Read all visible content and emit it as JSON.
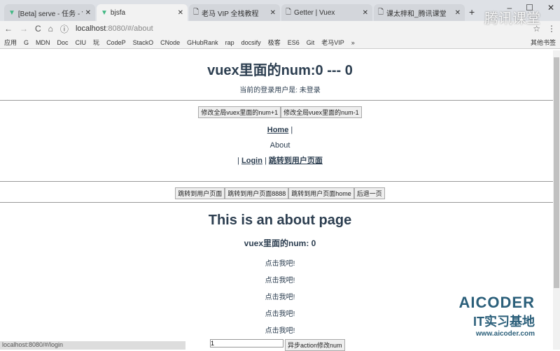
{
  "tabs": [
    {
      "label": "[Beta] serve - 任务 - Vue"
    },
    {
      "label": "bjsfa"
    },
    {
      "label": "老马 VIP 全栈教程"
    },
    {
      "label": "Getter | Vuex"
    },
    {
      "label": "课太梓和_腾讯课堂"
    }
  ],
  "url": {
    "host": "localhost",
    "rest": ":8080/#/about"
  },
  "bookmarks": [
    "应用",
    "G",
    "MDN",
    "Doc",
    "CIU",
    "玩",
    "CodeP",
    "StackO",
    "CNode",
    "GHubRank",
    "rap",
    "docsify",
    "极客",
    "ES6",
    "Git",
    "老马VIP",
    "»",
    "其他书签"
  ],
  "page": {
    "title": "vuex里面的num:0 --- 0",
    "user": "当前的登录用户是: 未登录",
    "buttons": [
      "修改全局vuex里面的num+1",
      "修改全局vuex里面的num-1"
    ],
    "nav": {
      "home": "Home",
      "sep": "|",
      "about": "About",
      "login": "Login",
      "user": "跳转到用户页面"
    },
    "route_buttons": [
      "跳转到用户页面",
      "跳转到用户页面8888",
      "跳转到用户页面home",
      "后退一页"
    ],
    "about_title": "This is an about page",
    "about_num": "vuex里面的num: 0",
    "clicks": [
      "点击我吧!",
      "点击我吧!",
      "点击我吧!",
      "点击我吧!",
      "点击我吧!"
    ],
    "input_value": "1",
    "async_button": "异步action修改num"
  },
  "status": "localhost:8080/#/login",
  "watermark": {
    "brand": "AICODER",
    "sub": "IT实习基地",
    "site": "www.aicoder.com",
    "tencent": "腾讯课堂"
  }
}
